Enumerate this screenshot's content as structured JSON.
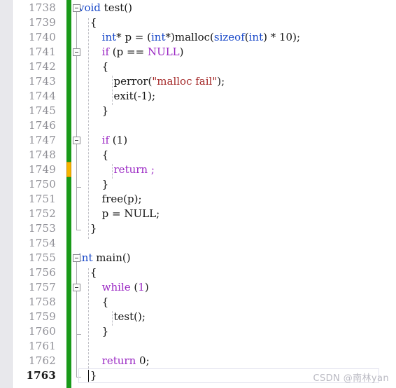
{
  "editor": {
    "app": "visual-studio-code-editor",
    "first_line": 1738,
    "last_line": 1763,
    "current_line": 1763,
    "colors": {
      "keyword_blue": "#1747c8",
      "keyword_purple": "#9b29c4",
      "string_red": "#a52a2a",
      "plain_text": "#141414",
      "line_number": "#8f8f96",
      "gutter_bg": "#e8e8ec",
      "change_bar_green": "#199a19",
      "save_marker_orange": "#f6b400",
      "indent_guide": "#c2c2c8",
      "fold_line": "#a9a9ae"
    }
  },
  "lines": [
    {
      "n": "1738",
      "indent": 0,
      "text": "void test()",
      "fold": "open",
      "tokens": [
        {
          "t": "void",
          "c": "kw-blue"
        },
        {
          "t": " test()",
          "c": "plain"
        }
      ]
    },
    {
      "n": "1739",
      "indent": 1,
      "text": "{",
      "fold": "none",
      "tokens": [
        {
          "t": "{",
          "c": "plain"
        }
      ]
    },
    {
      "n": "1740",
      "indent": 2,
      "text": "int* p = (int*)malloc(sizeof(int) * 10);",
      "fold": "none",
      "tokens": [
        {
          "t": "int",
          "c": "kw-blue"
        },
        {
          "t": "* p = (",
          "c": "plain"
        },
        {
          "t": "int",
          "c": "kw-blue"
        },
        {
          "t": "*)malloc(",
          "c": "plain"
        },
        {
          "t": "sizeof",
          "c": "kw-blue"
        },
        {
          "t": "(",
          "c": "plain"
        },
        {
          "t": "int",
          "c": "kw-blue"
        },
        {
          "t": ") * 10);",
          "c": "plain"
        }
      ]
    },
    {
      "n": "1741",
      "indent": 2,
      "text": "if (p == NULL)",
      "fold": "open",
      "tokens": [
        {
          "t": "if",
          "c": "kw-purple"
        },
        {
          "t": " (p == ",
          "c": "plain"
        },
        {
          "t": "NULL",
          "c": "macro"
        },
        {
          "t": ")",
          "c": "plain"
        }
      ]
    },
    {
      "n": "1742",
      "indent": 2,
      "text": "{",
      "fold": "none",
      "tokens": [
        {
          "t": "{",
          "c": "plain"
        }
      ]
    },
    {
      "n": "1743",
      "indent": 3,
      "text": "perror(\"malloc fail\");",
      "fold": "none",
      "tokens": [
        {
          "t": "perror(",
          "c": "plain"
        },
        {
          "t": "\"malloc fail\"",
          "c": "str"
        },
        {
          "t": ");",
          "c": "plain"
        }
      ]
    },
    {
      "n": "1744",
      "indent": 3,
      "text": "exit(-1);",
      "fold": "none",
      "tokens": [
        {
          "t": "exit(-1);",
          "c": "plain"
        }
      ]
    },
    {
      "n": "1745",
      "indent": 2,
      "text": "}",
      "fold": "none",
      "tokens": [
        {
          "t": "}",
          "c": "plain"
        }
      ]
    },
    {
      "n": "1746",
      "indent": 2,
      "text": "",
      "fold": "none",
      "tokens": []
    },
    {
      "n": "1747",
      "indent": 2,
      "text": "if (1)",
      "fold": "open",
      "tokens": [
        {
          "t": "if",
          "c": "kw-purple"
        },
        {
          "t": " (",
          "c": "plain"
        },
        {
          "t": "1",
          "c": "plain"
        },
        {
          "t": ")",
          "c": "plain"
        }
      ]
    },
    {
      "n": "1748",
      "indent": 2,
      "text": "{",
      "fold": "none",
      "tokens": [
        {
          "t": "{",
          "c": "plain"
        }
      ]
    },
    {
      "n": "1749",
      "indent": 3,
      "text": "return ;",
      "fold": "none",
      "tokens": [
        {
          "t": "return",
          "c": "kw-purple"
        },
        {
          "t": " ",
          "c": "plain"
        },
        {
          "t": ";",
          "c": "kw-purple"
        }
      ]
    },
    {
      "n": "1750",
      "indent": 2,
      "text": "}",
      "fold": "none",
      "tokens": [
        {
          "t": "}",
          "c": "plain"
        }
      ]
    },
    {
      "n": "1751",
      "indent": 2,
      "text": "free(p);",
      "fold": "none",
      "tokens": [
        {
          "t": "free(p);",
          "c": "plain"
        }
      ]
    },
    {
      "n": "1752",
      "indent": 2,
      "text": "p = NULL;",
      "fold": "none",
      "tokens": [
        {
          "t": "p = NULL;",
          "c": "plain"
        }
      ]
    },
    {
      "n": "1753",
      "indent": 1,
      "text": "}",
      "fold": "none",
      "tokens": [
        {
          "t": "}",
          "c": "plain"
        }
      ]
    },
    {
      "n": "1754",
      "indent": 0,
      "text": "",
      "fold": "none",
      "tokens": []
    },
    {
      "n": "1755",
      "indent": 0,
      "text": "int main()",
      "fold": "open",
      "tokens": [
        {
          "t": "int",
          "c": "kw-blue"
        },
        {
          "t": " main()",
          "c": "plain"
        }
      ]
    },
    {
      "n": "1756",
      "indent": 1,
      "text": "{",
      "fold": "none",
      "tokens": [
        {
          "t": "{",
          "c": "plain"
        }
      ]
    },
    {
      "n": "1757",
      "indent": 2,
      "text": "while (1)",
      "fold": "open",
      "tokens": [
        {
          "t": "while",
          "c": "kw-purple"
        },
        {
          "t": " (",
          "c": "plain"
        },
        {
          "t": "1",
          "c": "kw-purple"
        },
        {
          "t": ")",
          "c": "plain"
        }
      ]
    },
    {
      "n": "1758",
      "indent": 2,
      "text": "{",
      "fold": "none",
      "tokens": [
        {
          "t": "{",
          "c": "plain"
        }
      ]
    },
    {
      "n": "1759",
      "indent": 3,
      "text": "test();",
      "fold": "none",
      "tokens": [
        {
          "t": "test();",
          "c": "plain"
        }
      ]
    },
    {
      "n": "1760",
      "indent": 2,
      "text": "}",
      "fold": "none",
      "tokens": [
        {
          "t": "}",
          "c": "plain"
        }
      ]
    },
    {
      "n": "1761",
      "indent": 2,
      "text": "",
      "fold": "none",
      "tokens": []
    },
    {
      "n": "1762",
      "indent": 2,
      "text": "return 0;",
      "fold": "none",
      "tokens": [
        {
          "t": "return",
          "c": "kw-purple"
        },
        {
          "t": " ",
          "c": "plain"
        },
        {
          "t": "0",
          "c": "plain"
        },
        {
          "t": ";",
          "c": "plain"
        }
      ]
    },
    {
      "n": "1763",
      "indent": 1,
      "text": "}",
      "fold": "none",
      "tokens": [
        {
          "t": "}",
          "c": "plain"
        }
      ]
    }
  ],
  "watermark": {
    "label": "CSDN @南林yan"
  }
}
